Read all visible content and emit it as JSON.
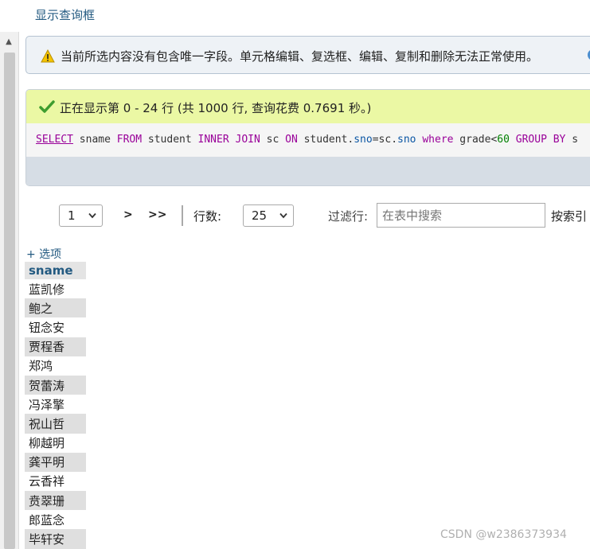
{
  "header": {
    "show_query_label": "显示查询框"
  },
  "warning": {
    "text": "当前所选内容没有包含唯一字段。单元格编辑、复选框、编辑、复制和删除无法正常使用。",
    "icon": "warning-icon",
    "help_icon": "help-icon"
  },
  "result": {
    "success_text": "正在显示第 0 - 24 行 (共 1000 行, 查询花费 0.7691 秒。)",
    "icon": "check-icon",
    "sql": {
      "t1": "SELECT",
      "t2": " sname ",
      "t3": "FROM",
      "t4": " student ",
      "t5": "INNER JOIN",
      "t6": " sc ",
      "t7": "ON",
      "t8": " student.",
      "t9": "sno",
      "t10": "=sc.",
      "t11": "sno",
      "t12": " ",
      "t13": "where",
      "t14": " grade<",
      "t15": "60",
      "t16": " ",
      "t17": "GROUP BY",
      "t18": " s"
    }
  },
  "navigation": {
    "page_value": "1",
    "next_label": ">",
    "last_label": ">>",
    "rows_label": "行数:",
    "rows_value": "25",
    "filter_label": "过滤行:",
    "filter_placeholder": "在表中搜索",
    "sort_label": "按索引"
  },
  "options_label": "+ 选项",
  "table": {
    "column": "sname",
    "rows": [
      "蓝凯修",
      "鲍之",
      "钮念安",
      "贾程香",
      "郑鸿",
      "贺蕾涛",
      "冯泽擎",
      "祝山哲",
      "柳越明",
      "龚平明",
      "云香祥",
      "贲翠珊",
      "郎蓝念",
      "毕轩安"
    ]
  },
  "watermark": "CSDN @w2386373934",
  "colors": {
    "success_bg": "#ebf8a4",
    "warning_bg": "#eef2f6",
    "link": "#235a81"
  }
}
